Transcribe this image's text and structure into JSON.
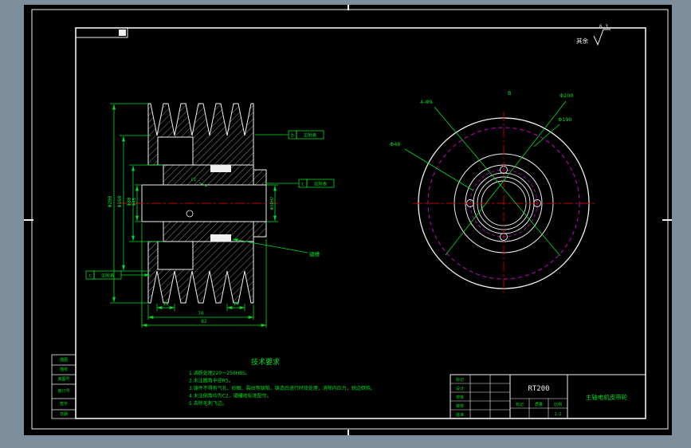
{
  "colors": {
    "background": "#7d8e9c",
    "paper": "#000000",
    "line": "#f0f0f0",
    "annotation": "#00dd22",
    "centerline": "#c00000",
    "phantom": "#dd00dd"
  },
  "surface_note": {
    "prefix": "其余",
    "value": "6.3"
  },
  "left_view": {
    "dims": {
      "outer": "Φ200",
      "groove": "Φ160",
      "hub": "Φ80",
      "snout": "Φ45",
      "bore": "Φ38H7",
      "tooth1": "19",
      "tooth2": "14",
      "width": "70",
      "overall": "82",
      "chamfer": "C1"
    },
    "callouts": {
      "b_ref": {
        "letter": "b",
        "text": "见附表"
      },
      "c_ref1": {
        "letter": "c",
        "text": "见附表"
      },
      "c_ref2": {
        "letter": "c",
        "text": "见附表"
      },
      "keyway": "键槽"
    }
  },
  "right_view": {
    "labels": {
      "holes": "4-Φ9",
      "outer": "Φ200",
      "pitch": "Φ190",
      "hub": "Φ48"
    },
    "section_mark": "B"
  },
  "tech_requirements": {
    "title": "技术要求",
    "lines": [
      "1.调质处理220～250HBS。",
      "2.未注圆角半径R5。",
      "3.铸件不得有气孔、砂眼、裂纹等缺陷，铸造后进行时效处理，消除内应力，锐边倒钝。",
      "4.未注倒角均为C2，键槽按标准配作。",
      "5.去除毛刺飞边。"
    ]
  },
  "title_block": {
    "drawing_no": "RT200",
    "part_name": "主轴电机皮带轮",
    "sign_labels": [
      "标记",
      "设计",
      "校核",
      "审核",
      "批准"
    ],
    "stage_labels": [
      "标记",
      "质量",
      "比例"
    ],
    "scale": "1:2"
  },
  "margin_table": {
    "rows": [
      "描图",
      "描校",
      "底图号",
      "装订号",
      "签字",
      "日期"
    ]
  }
}
